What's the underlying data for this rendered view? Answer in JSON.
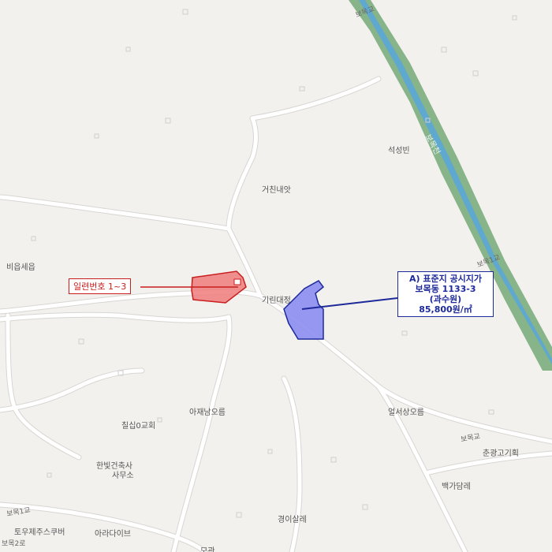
{
  "labels": {
    "river_name": "보목천",
    "bridge_top": "보목교",
    "bridge_mid": "보목1교",
    "bridge_lower_left": "보목1교",
    "bridge_lower_right": "보목교",
    "seokseongbin": "석성빈",
    "geochinnaeot": "거친내앗",
    "bieumsesang": "비읍세읍",
    "girindaejeong": "기린대정",
    "ajaenamoreum": "아재남오름",
    "chilsimgyohoe": "칠십0교회",
    "hanbit_office_1": "한빛건축사",
    "hanbit_office_2": "사무소",
    "yeonseonsangoreum": "얼서상오름",
    "chungwang": "춘광고기획",
    "baekgadam": "백가담레",
    "gyeongisal": "경이살레",
    "araedabae": "아라다이브",
    "toujeju": "토우제주스쿠버",
    "bottom_center": "모관",
    "bottom_left_road": "보목2로"
  },
  "callouts": {
    "red_label": "일련번호 1~3",
    "blue_line1": "A) 표준지 공시지가",
    "blue_line2": "보목동 1133-3",
    "blue_line3": "(과수원)",
    "blue_line4": "85,800원/㎡"
  },
  "colors": {
    "background": "#f2f1ee",
    "road": "#ffffff",
    "road_edge": "#d8d6d2",
    "building": "#d6d6d6",
    "river_bank": "#88b48a",
    "river_water": "#5fa8cf",
    "red_parcel": "#f07c7c",
    "red_outline": "#c81e1e",
    "blue_parcel": "#8b8df0",
    "blue_outline": "#1e2a9a"
  }
}
